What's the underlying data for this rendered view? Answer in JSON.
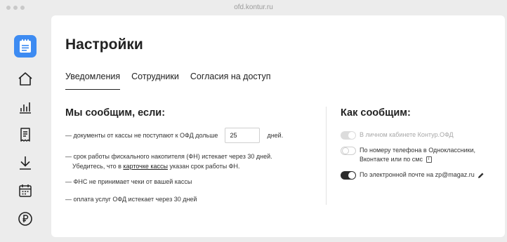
{
  "browser": {
    "url": "ofd.kontur.ru"
  },
  "sidebar": {
    "items": [
      {
        "icon": "notepad-icon",
        "active": true
      },
      {
        "icon": "home-icon"
      },
      {
        "icon": "bar-chart-icon"
      },
      {
        "icon": "receipt-icon"
      },
      {
        "icon": "download-icon"
      },
      {
        "icon": "calendar-icon"
      },
      {
        "icon": "ruble-icon"
      }
    ]
  },
  "page": {
    "title": "Настройки"
  },
  "tabs": [
    {
      "label": "Уведомления",
      "active": true
    },
    {
      "label": "Сотрудники"
    },
    {
      "label": "Согласия на доступ"
    }
  ],
  "notify_when": {
    "title": "Мы сообщим, если:",
    "rule1": {
      "before": "— документы от кассы не поступают к ОФД дольше",
      "value": "25",
      "after": "дней."
    },
    "rule2": {
      "line1": "— срок работы фискального накопителя (ФН) истекает через 30 дней.",
      "line2_before": "Убедитесь, что в",
      "link": "карточке кассы",
      "line2_after": "указан срок работы ФН."
    },
    "rule3": "— ФНС не принимает чеки от вашей кассы",
    "rule4": "— оплата услуг ОФД истекает через 30 дней"
  },
  "notify_how": {
    "title": "Как сообщим:",
    "options": [
      {
        "label": "В личном кабинете Контур.ОФД",
        "state": "disabled-on"
      },
      {
        "label_line1": "По номеру телефона в Одноклассники,",
        "label_line2": "Вконтакте или по смс",
        "state": "off"
      },
      {
        "label": "По электронной почте на zp@magaz.ru",
        "state": "on"
      }
    ]
  },
  "colors": {
    "accent": "#3d8bf2",
    "toggle_on": "#2c2c2c",
    "toggle_disabled": "#dcdcdc"
  }
}
